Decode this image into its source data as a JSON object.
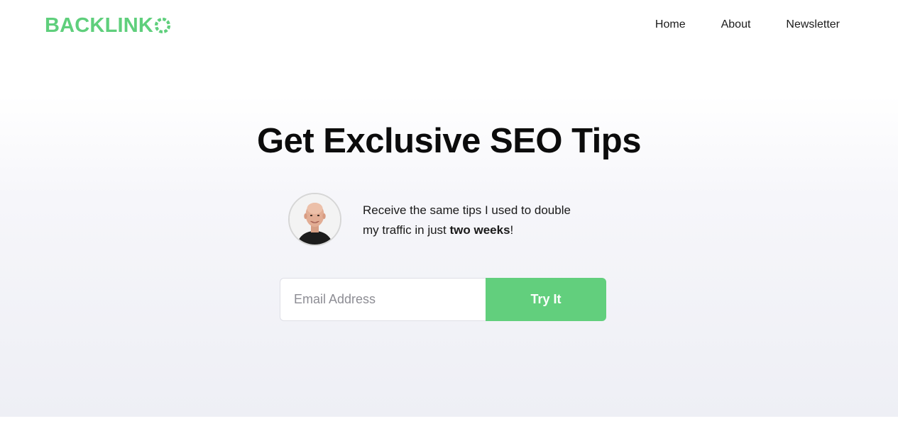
{
  "header": {
    "logo_text": "BACKLINK",
    "logo_color": "#5fcf7c",
    "nav": [
      {
        "label": "Home"
      },
      {
        "label": "About"
      },
      {
        "label": "Newsletter"
      }
    ]
  },
  "hero": {
    "title": "Get Exclusive SEO Tips",
    "intro_line_1": "Receive the same tips I used to double",
    "intro_line_2_prefix": "my traffic in just ",
    "intro_line_2_bold": "two weeks",
    "intro_line_2_suffix": "!",
    "avatar_icon": "person-photo"
  },
  "signup": {
    "email_placeholder": "Email Address",
    "email_value": "",
    "button_label": "Try It",
    "button_color": "#62cf7d"
  }
}
